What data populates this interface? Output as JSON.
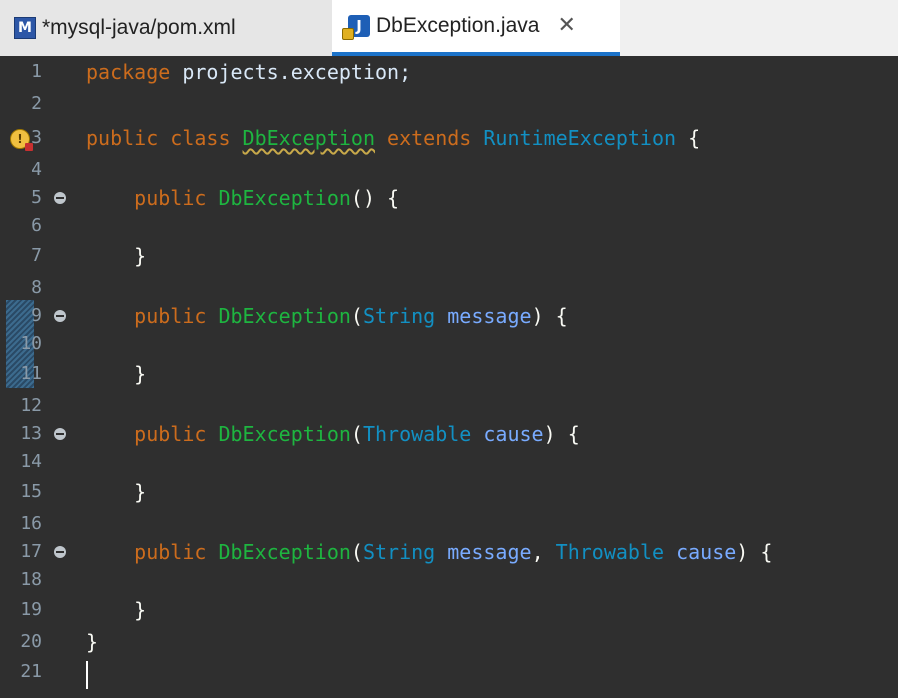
{
  "tabs": [
    {
      "label": "*mysql-java/pom.xml",
      "icon": "maven-file-icon",
      "active": false
    },
    {
      "label": "DbException.java",
      "icon": "java-file-icon",
      "active": true
    }
  ],
  "editor": {
    "line_numbers": [
      "1",
      "2",
      "3",
      "4",
      "5",
      "6",
      "7",
      "8",
      "9",
      "10",
      "11",
      "12",
      "13",
      "14",
      "15",
      "16",
      "17",
      "18",
      "19",
      "20",
      "21"
    ],
    "code": {
      "l1_kw": "package",
      "l1_rest": " projects.exception;",
      "l3_kw": "public class",
      "l3_name": "DbException",
      "l3_kw2": "extends",
      "l3_type": "RuntimeException",
      "l3_brace": "{",
      "ctor_kw": "public",
      "ctor_name": "DbException",
      "l5_sig": "() {",
      "l9_open": "(",
      "l9_type": "String",
      "l9_param": "message",
      "l9_close": ") {",
      "l13_type": "Throwable",
      "l13_param": "cause",
      "l17_comma": ",",
      "close_brace": "}",
      "l20": "}"
    },
    "annotations": {
      "warning_line": "3",
      "folded_lines": [
        "5",
        "9",
        "13",
        "17"
      ]
    }
  },
  "colors": {
    "keyword": "#cc6c1d",
    "type": "#1290c3",
    "method": "#1eb540",
    "param": "#79abff",
    "background": "#2f2f2f"
  }
}
